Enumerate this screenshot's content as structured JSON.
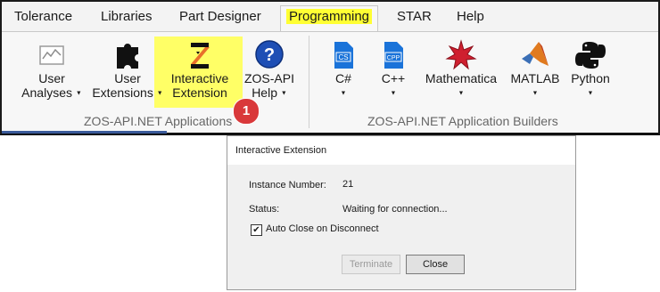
{
  "ribbon": {
    "tabs": [
      "Tolerance",
      "Libraries",
      "Part Designer",
      "Programming",
      "STAR",
      "Help"
    ],
    "active_tab": "Programming",
    "groups": [
      {
        "label": "ZOS-API.NET Applications",
        "buttons": [
          {
            "line1": "User",
            "line2": "Analyses",
            "icon": "chart-icon",
            "dropdown": true
          },
          {
            "line1": "User",
            "line2": "Extensions",
            "icon": "puzzle-icon",
            "dropdown": true
          },
          {
            "line1": "Interactive",
            "line2": "Extension",
            "icon": "interactive-extension-icon",
            "dropdown": false,
            "highlighted": true
          },
          {
            "line1": "ZOS-API",
            "line2": "Help",
            "icon": "help-icon",
            "dropdown": true
          }
        ]
      },
      {
        "label": "ZOS-API.NET Application Builders",
        "buttons": [
          {
            "line1": "C#",
            "icon": "csharp-file-icon",
            "icon_text": "CS"
          },
          {
            "line1": "C++",
            "icon": "cpp-file-icon",
            "icon_text": "CPP"
          },
          {
            "line1": "Mathematica",
            "icon": "mathematica-icon"
          },
          {
            "line1": "MATLAB",
            "icon": "matlab-icon"
          },
          {
            "line1": "Python",
            "icon": "python-icon"
          }
        ]
      }
    ],
    "callout_number": "1"
  },
  "dialog": {
    "title": "Interactive Extension",
    "instance_label": "Instance Number:",
    "instance_value": "21",
    "status_label": "Status:",
    "status_value": "Waiting for connection...",
    "auto_close_label": "Auto Close on Disconnect",
    "auto_close_checked": true,
    "terminate_label": "Terminate",
    "close_label": "Close"
  },
  "colors": {
    "highlight": "#ffff66",
    "callout": "#d9383a",
    "cs_blue": "#1a73d9"
  }
}
